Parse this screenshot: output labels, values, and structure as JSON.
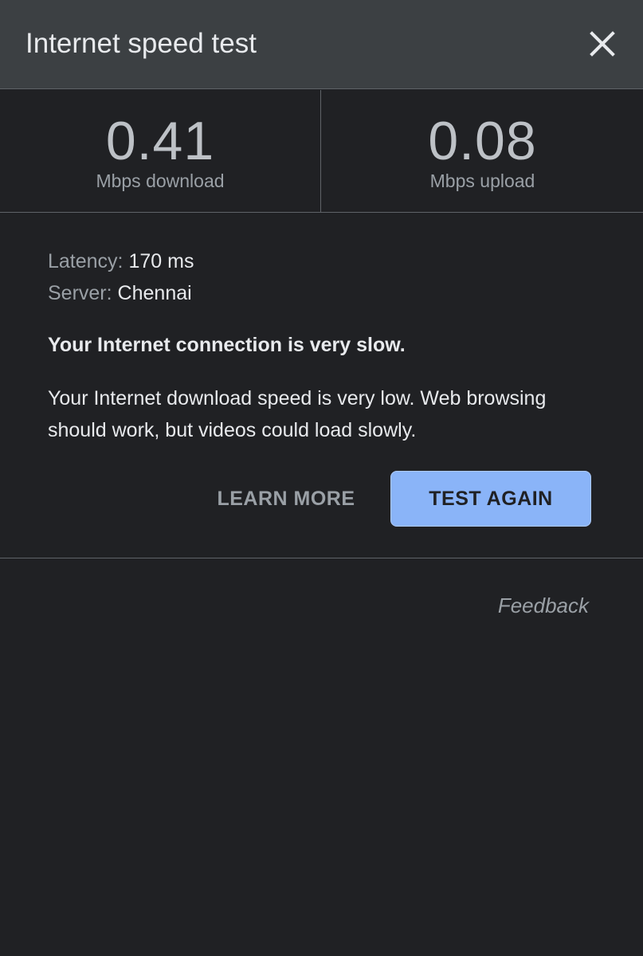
{
  "header": {
    "title": "Internet speed test",
    "close_icon": "close-icon"
  },
  "stats": {
    "download": {
      "value": "0.41",
      "unit": "Mbps download"
    },
    "upload": {
      "value": "0.08",
      "unit": "Mbps upload"
    }
  },
  "details": {
    "latency_label": "Latency:",
    "latency_value": "170 ms",
    "server_label": "Server:",
    "server_value": "Chennai"
  },
  "message": {
    "headline": "Your Internet connection is very slow.",
    "description": "Your Internet download speed is very low. Web browsing should work, but videos could load slowly."
  },
  "actions": {
    "learn_more": "LEARN MORE",
    "test_again": "TEST AGAIN"
  },
  "footer": {
    "feedback": "Feedback"
  },
  "colors": {
    "background": "#202124",
    "header_bg": "#3c4043",
    "accent": "#8ab4f8",
    "divider": "#5f6368"
  }
}
